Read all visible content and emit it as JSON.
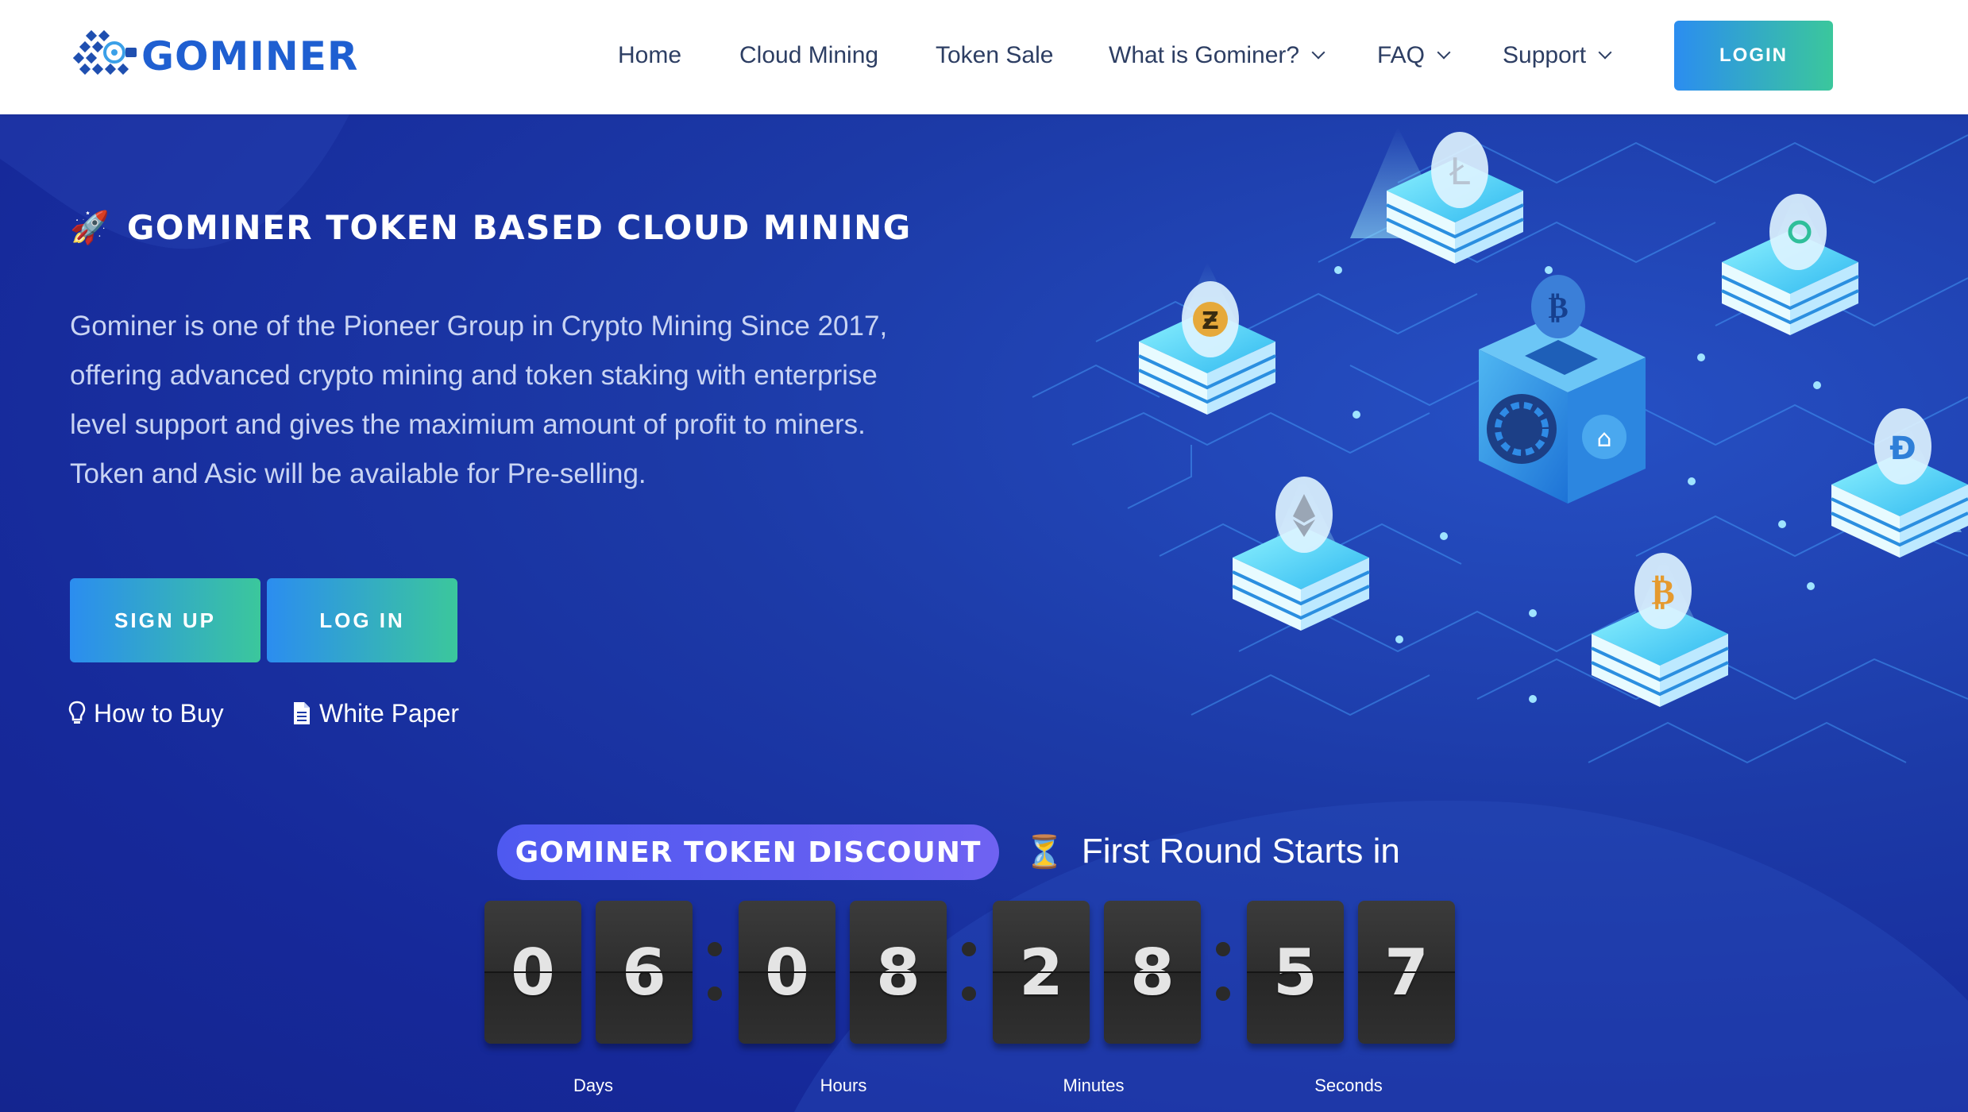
{
  "brand": {
    "name": "GOMINER"
  },
  "nav": {
    "items": [
      {
        "label": "Home",
        "dropdown": false
      },
      {
        "label": "Cloud Mining",
        "dropdown": false
      },
      {
        "label": "Token Sale",
        "dropdown": false
      },
      {
        "label": "What is Gominer?",
        "dropdown": true
      },
      {
        "label": "FAQ",
        "dropdown": true
      },
      {
        "label": "Support",
        "dropdown": true
      }
    ],
    "login_label": "LOGIN"
  },
  "hero": {
    "title": "GOMINER TOKEN BASED CLOUD MINING",
    "description": "Gominer is one of the Pioneer Group in Crypto Mining Since 2017, offering advanced crypto mining and token staking with enterprise level support and gives the maximium amount of profit to miners. Token and Asic will be available for Pre-selling.",
    "signup_label": "SIGN UP",
    "login_label": "LOG IN",
    "how_to_buy_label": "How to Buy",
    "white_paper_label": "White Paper"
  },
  "countdown": {
    "discount_label": "GOMINER TOKEN DISCOUNT",
    "round_label": "First Round Starts in",
    "digits": [
      "0",
      "6",
      "0",
      "8",
      "2",
      "8",
      "5",
      "7"
    ],
    "units": [
      "Days",
      "Hours",
      "Minutes",
      "Seconds"
    ]
  },
  "colors": {
    "hero_bg": "#1c3aa7",
    "button_gradient_start": "#2b8df0",
    "button_gradient_end": "#3bc79c",
    "pill": "#5a5df1",
    "brand_blue": "#1f5fd1"
  },
  "icons": {
    "title": "rocket-icon",
    "round": "hourglass-icon",
    "how_to_buy": "lightbulb-icon",
    "white_paper": "document-icon"
  }
}
